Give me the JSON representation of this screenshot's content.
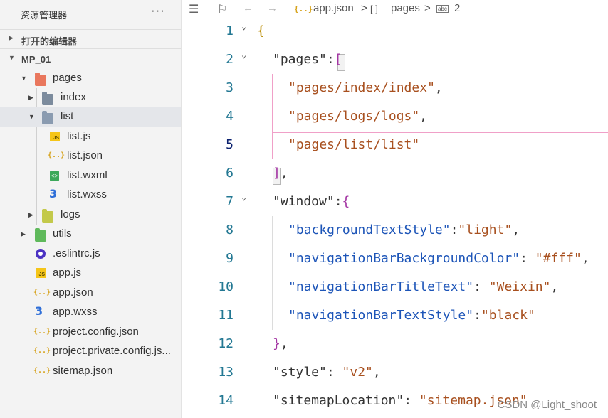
{
  "sidebar": {
    "title": "资源管理器",
    "more": "···",
    "open_editors": "打开的编辑器",
    "project": "MP_01",
    "tree": [
      {
        "name": "pages"
      },
      {
        "name": "index"
      },
      {
        "name": "list"
      },
      {
        "name": "list.js"
      },
      {
        "name": "list.json"
      },
      {
        "name": "list.wxml"
      },
      {
        "name": "list.wxss"
      },
      {
        "name": "logs"
      },
      {
        "name": "utils"
      },
      {
        "name": ".eslintrc.js"
      },
      {
        "name": "app.js"
      },
      {
        "name": "app.json"
      },
      {
        "name": "app.wxss"
      },
      {
        "name": "project.config.json"
      },
      {
        "name": "project.private.config.js..."
      },
      {
        "name": "sitemap.json"
      }
    ]
  },
  "icons": {
    "js_badge": "JS",
    "json_badge": "{..}",
    "wxml_badge": "<>",
    "wxss_badge": "3"
  },
  "breadcrumb": {
    "file": "app.json",
    "sep": ">",
    "arr_icon": "[ ]",
    "section": "pages",
    "badge": "abc",
    "item": "2"
  },
  "editor": {
    "line_numbers": [
      "1",
      "2",
      "3",
      "4",
      "5",
      "6",
      "7",
      "8",
      "9",
      "10",
      "11",
      "12",
      "13",
      "14"
    ],
    "lines": {
      "l1_open": "{",
      "l2_key": "\"pages\"",
      "l2_colon": ":",
      "l2_open": "[",
      "l3_str": "\"pages/index/index\"",
      "l3_comma": ",",
      "l4_str": "\"pages/logs/logs\"",
      "l4_comma": ",",
      "l5_str": "\"pages/list/list\"",
      "l6_close": "]",
      "l6_comma": ",",
      "l7_key": "\"window\"",
      "l7_colon": ":",
      "l7_open": "{",
      "l8_key": "\"backgroundTextStyle\"",
      "l8_colon": ":",
      "l8_val": "\"light\"",
      "l8_comma": ",",
      "l9_key": "\"navigationBarBackgroundColor\"",
      "l9_colon": ": ",
      "l9_val": "\"#fff\"",
      "l9_comma": ",",
      "l10_key": "\"navigationBarTitleText\"",
      "l10_colon": ": ",
      "l10_val": "\"Weixin\"",
      "l10_comma": ",",
      "l11_key": "\"navigationBarTextStyle\"",
      "l11_colon": ":",
      "l11_val": "\"black\"",
      "l12_close": "}",
      "l12_comma": ",",
      "l13_key": "\"style\"",
      "l13_colon": ": ",
      "l13_val": "\"v2\"",
      "l13_comma": ",",
      "l14_key": "\"sitemapLocation\"",
      "l14_colon": ": ",
      "l14_val": "\"sitemap.json\""
    }
  },
  "watermark": "CSDN @Light_shoot",
  "colors": {
    "string": "#a8501f",
    "key_nested": "#1d55b8",
    "bracket_gold": "#b98b00",
    "bracket_purple": "#a334a3",
    "bracket_blue": "#2a7bd4",
    "line_number": "#237893"
  }
}
